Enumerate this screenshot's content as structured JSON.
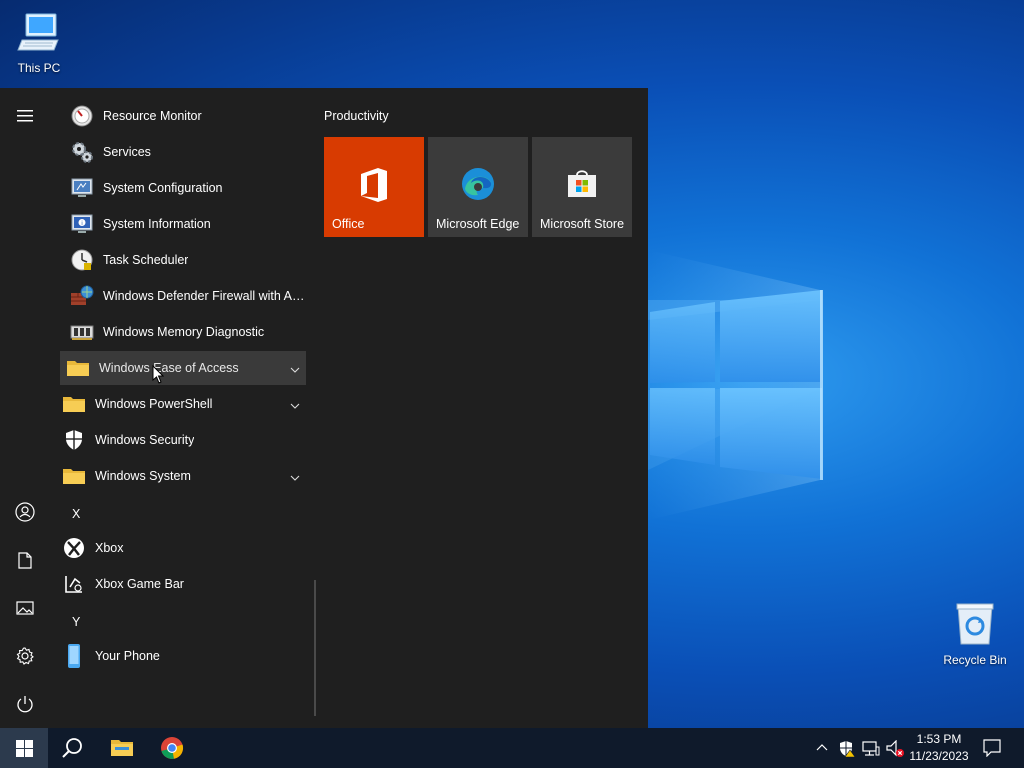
{
  "desktop": {
    "icons": [
      {
        "label": "This PC",
        "icon": "computer-icon"
      },
      {
        "label": "Recycle Bin",
        "icon": "recycle-bin-icon"
      }
    ]
  },
  "start_menu": {
    "rail": [
      {
        "icon": "hamburger-menu-icon"
      },
      {
        "icon": "user-account-icon"
      },
      {
        "icon": "documents-icon"
      },
      {
        "icon": "pictures-icon"
      },
      {
        "icon": "settings-gear-icon"
      },
      {
        "icon": "power-icon"
      }
    ],
    "apps": [
      {
        "label": "Resource Monitor",
        "icon": "resource-monitor-icon"
      },
      {
        "label": "Services",
        "icon": "services-gears-icon"
      },
      {
        "label": "System Configuration",
        "icon": "system-configuration-icon"
      },
      {
        "label": "System Information",
        "icon": "system-information-icon"
      },
      {
        "label": "Task Scheduler",
        "icon": "task-scheduler-clock-icon"
      },
      {
        "label": "Windows Defender Firewall with Ad...",
        "icon": "firewall-icon"
      },
      {
        "label": "Windows Memory Diagnostic",
        "icon": "memory-chip-icon"
      },
      {
        "label": "Windows Ease of Access",
        "icon": "folder-icon",
        "expandable": true,
        "hovered": true
      },
      {
        "label": "Windows PowerShell",
        "icon": "folder-icon",
        "expandable": true
      },
      {
        "label": "Windows Security",
        "icon": "shield-icon"
      },
      {
        "label": "Windows System",
        "icon": "folder-icon",
        "expandable": true
      }
    ],
    "letter_x": "X",
    "apps_x": [
      {
        "label": "Xbox",
        "icon": "xbox-icon"
      },
      {
        "label": "Xbox Game Bar",
        "icon": "xbox-game-bar-icon"
      }
    ],
    "letter_y": "Y",
    "apps_y": [
      {
        "label": "Your Phone",
        "icon": "phone-icon"
      }
    ],
    "tile_group": "Productivity",
    "tiles": [
      {
        "label": "Office",
        "icon": "office-logo-icon",
        "bg": "#d83b01"
      },
      {
        "label": "Microsoft Edge",
        "icon": "edge-logo-icon",
        "bg": "#3b3b3b"
      },
      {
        "label": "Microsoft Store",
        "icon": "store-bag-icon",
        "bg": "#3b3b3b"
      }
    ]
  },
  "taskbar": {
    "buttons": [
      {
        "icon": "windows-start-icon"
      },
      {
        "icon": "search-icon"
      },
      {
        "icon": "file-explorer-icon"
      },
      {
        "icon": "chrome-icon"
      }
    ],
    "tray": [
      {
        "icon": "chevron-up-icon"
      },
      {
        "icon": "security-warning-icon"
      },
      {
        "icon": "network-icon"
      },
      {
        "icon": "volume-muted-icon"
      }
    ],
    "time": "1:53 PM",
    "date": "11/23/2023",
    "notifications_icon": "action-center-icon"
  },
  "colors": {
    "menu_bg": "#1f1f1f",
    "office_tile": "#d83b01",
    "tile_bg": "#3b3b3b",
    "taskbar_bg": "#0f1a2b"
  }
}
